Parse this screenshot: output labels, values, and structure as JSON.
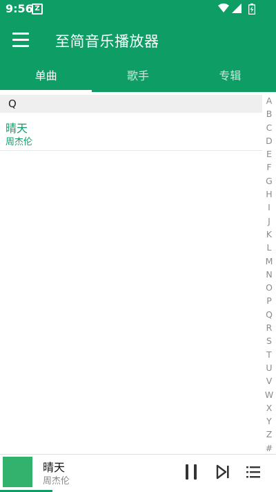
{
  "status_bar": {
    "time": "9:56",
    "notification_icon": "z-notification-icon",
    "icons": [
      "wifi-icon",
      "cell-signal-icon",
      "battery-charging-icon"
    ]
  },
  "app_bar": {
    "menu_icon": "hamburger-menu-icon",
    "title": "至简音乐播放器"
  },
  "tabs": [
    {
      "label": "单曲",
      "active": true
    },
    {
      "label": "歌手",
      "active": false
    },
    {
      "label": "专辑",
      "active": false
    }
  ],
  "song_list": {
    "section_letter": "Q",
    "items": [
      {
        "title": "晴天",
        "artist": "周杰伦"
      }
    ]
  },
  "index_bar": {
    "letters": [
      "A",
      "B",
      "C",
      "D",
      "E",
      "F",
      "G",
      "H",
      "I",
      "J",
      "K",
      "L",
      "M",
      "N",
      "O",
      "P",
      "Q",
      "R",
      "S",
      "T",
      "U",
      "V",
      "W",
      "X",
      "Y",
      "Z",
      "#"
    ]
  },
  "player": {
    "title": "晴天",
    "artist": "周杰伦",
    "album_art_color": "#33b26e",
    "progress_fraction": 0.19,
    "controls": [
      "pause-icon",
      "skip-next-icon",
      "playlist-icon"
    ]
  },
  "colors": {
    "primary": "#0f9d66",
    "section_bg": "#efefef",
    "index_text": "#8a8a8a"
  }
}
